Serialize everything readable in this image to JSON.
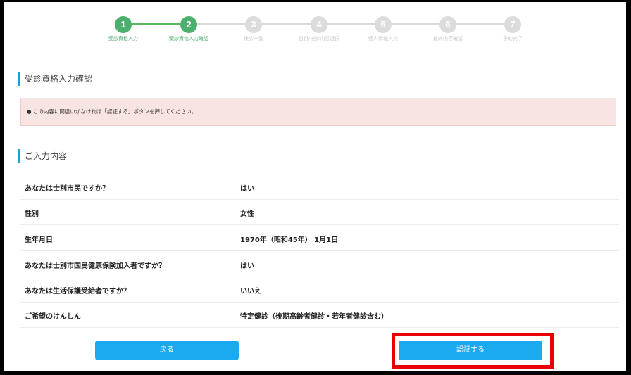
{
  "steps": [
    {
      "num": "1",
      "label": "受診資格入力",
      "done": true
    },
    {
      "num": "2",
      "label": "受診資格入力確認",
      "done": true
    },
    {
      "num": "3",
      "label": "検診一覧",
      "done": false
    },
    {
      "num": "4",
      "label": "日付/検診内容選択",
      "done": false
    },
    {
      "num": "5",
      "label": "個人情報入力",
      "done": false
    },
    {
      "num": "6",
      "label": "最終内容確認",
      "done": false
    },
    {
      "num": "7",
      "label": "予約完了",
      "done": false
    }
  ],
  "section_title": "受診資格入力確認",
  "alert": "●  この内容に間違いがなければ「認証する」ボタンを押してください。",
  "input_title": "ご入力内容",
  "rows": [
    {
      "q": "あなたは士別市民ですか？",
      "a": "はい"
    },
    {
      "q": "性別",
      "a": "女性"
    },
    {
      "q": "生年月日",
      "a": "1970年（昭和45年） 1月1日"
    },
    {
      "q": "あなたは士別市国民健康保険加入者ですか？",
      "a": "はい"
    },
    {
      "q": "あなたは生活保護受給者ですか？",
      "a": "いいえ"
    },
    {
      "q": "ご希望のけんしん",
      "a": "特定健診（後期高齢者健診・若年者健診含む）"
    }
  ],
  "buttons": {
    "back": "戻る",
    "confirm": "認証する"
  },
  "colors": {
    "accent": "#1aaaf0",
    "step_done": "#4caf6d",
    "alert_bg": "#f9e4e4",
    "highlight": "#e60000"
  }
}
